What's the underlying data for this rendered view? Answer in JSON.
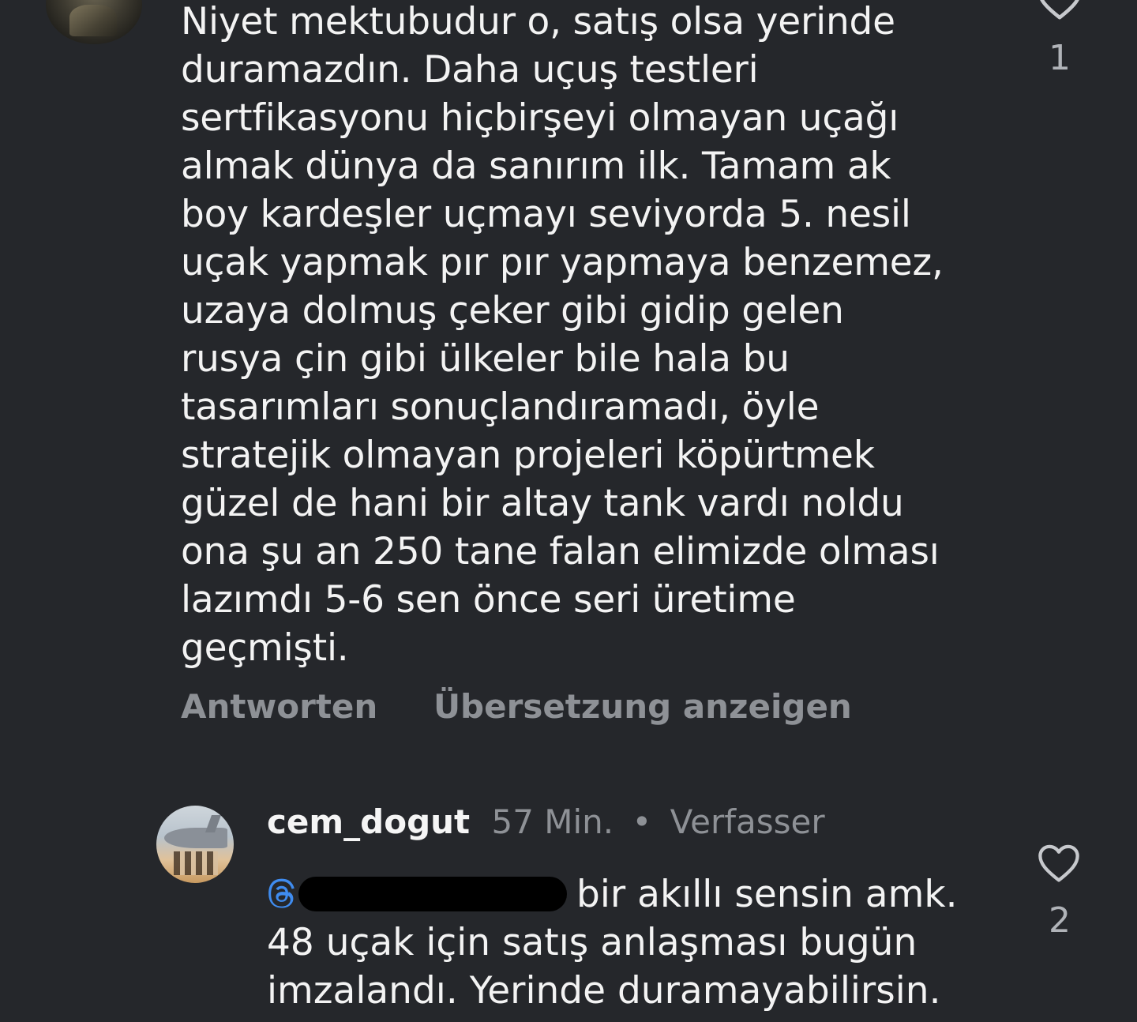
{
  "comment_1": {
    "text": "Niyet mektubudur o, satış olsa yerinde\nduramazdın. Daha uçuş testleri\nsertfikasyonu hiçbirşeyi olmayan uçağı\nalmak dünya da sanırım ilk. Tamam ak\nboy kardeşler uçmayı seviyorda 5. nesil\nuçak yapmak pır pır yapmaya benzemez,\nuzaya dolmuş çeker gibi gidip gelen\nrusya çin gibi ülkeler bile hala bu\ntasarımları sonuçlandıramadı, öyle\nstratejik olmayan projeleri köpürtmek\ngüzel de hani bir altay tank vardı noldu\nona şu an 250 tane falan elimizde olması\nlazımdı 5-6 sen önce seri üretime\ngeçmişti.",
    "likes": "1",
    "actions": {
      "reply": "Antworten",
      "translate": "Übersetzung anzeigen"
    }
  },
  "comment_2": {
    "username": "cem_dogut",
    "time": "57 Min.",
    "separator": "•",
    "badge": "Verfasser",
    "text_after_mention": "bir akıllı sensin amk.",
    "text_rest": "48 uçak için satış anlaşması bugün imzalandı. Yerinde duramayabilirsin.",
    "likes": "2"
  },
  "icons": {
    "like": "heart-outline-icon",
    "mention": "threads-at-icon"
  },
  "colors": {
    "background": "#25272b",
    "text": "#f3f3f3",
    "secondary": "#8e9196",
    "mention": "#3f8cf0"
  }
}
